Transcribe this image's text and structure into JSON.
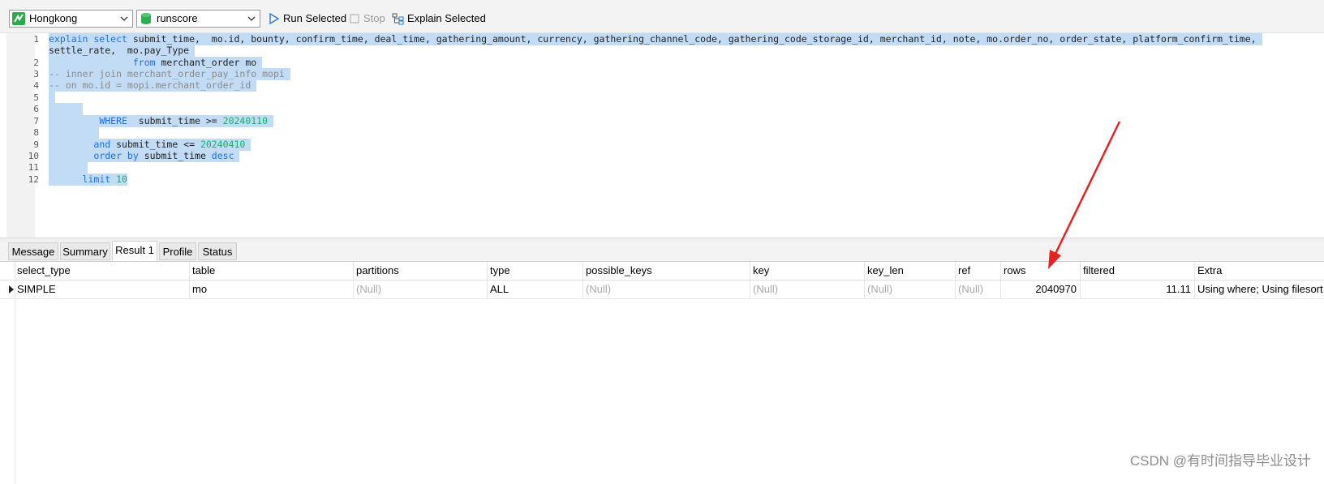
{
  "toolbar": {
    "connection": "Hongkong",
    "database": "runscore",
    "run_selected": "Run Selected",
    "stop": "Stop",
    "explain_selected": "Explain Selected"
  },
  "editor": {
    "line_numbers": [
      "1",
      "2",
      "3",
      "4",
      "5",
      "6",
      "7",
      "8",
      "9",
      "10",
      "11",
      "12"
    ],
    "l1_kw": "explain select",
    "l1_rest": " submit_time,  mo.id, bounty, confirm_time, deal_time, gathering_amount, currency, gathering_channel_code, gathering_code_storage_id, merchant_id, note, mo.order_no, order_state, platform_confirm_time, ",
    "l1_wrap": "settle_rate,  mo.pay_Type ",
    "l2_kw": "from",
    "l2_rest": " merchant_order mo ",
    "l3": "-- inner join merchant_order_pay_info mopi ",
    "l4": "-- on mo.id = mopi.merchant_order_id ",
    "l7_kw": "WHERE",
    "l7_mid": "  submit_time >= ",
    "l7_num": "20240110",
    "l9_kw": "and",
    "l9_mid": " submit_time <= ",
    "l9_num": "20240410",
    "l10_kw1": "order by",
    "l10_mid": " submit_time ",
    "l10_kw2": "desc",
    "l12_kw": "limit",
    "l12_num": "10"
  },
  "tabs": [
    "Message",
    "Summary",
    "Result 1",
    "Profile",
    "Status"
  ],
  "active_tab": "Result 1",
  "result": {
    "columns": [
      "select_type",
      "table",
      "partitions",
      "type",
      "possible_keys",
      "key",
      "key_len",
      "ref",
      "rows",
      "filtered",
      "Extra"
    ],
    "row": [
      "SIMPLE",
      "mo",
      "(Null)",
      "ALL",
      "(Null)",
      "(Null)",
      "(Null)",
      "(Null)",
      "2040970",
      "11.11",
      "Using where; Using filesort"
    ]
  },
  "watermark": "CSDN @有时间指导毕业设计",
  "colors": {
    "selection": "#c3dcf6",
    "keyword": "#1e6fe0",
    "number": "#10b368",
    "comment": "#8a8a8a",
    "annotation_arrow": "#e8231f"
  }
}
